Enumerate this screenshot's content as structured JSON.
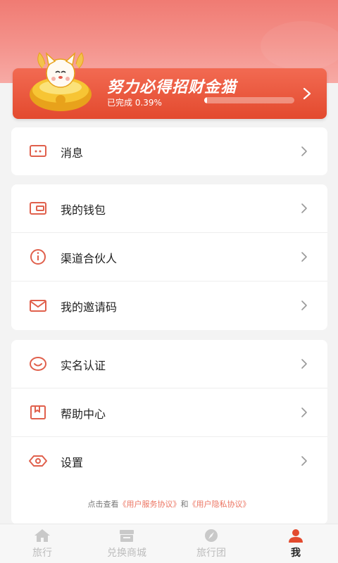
{
  "banner": {
    "title": "努力必得招财金猫",
    "progress_text": "已完成 0.39%",
    "progress_value": 0.0039
  },
  "menu_groups": [
    {
      "items": [
        {
          "label": "消息",
          "icon": "message-icon"
        }
      ]
    },
    {
      "items": [
        {
          "label": "我的钱包",
          "icon": "wallet-icon"
        },
        {
          "label": "渠道合伙人",
          "icon": "info-icon"
        },
        {
          "label": "我的邀请码",
          "icon": "mail-icon"
        }
      ]
    },
    {
      "items": [
        {
          "label": "实名认证",
          "icon": "smile-icon"
        },
        {
          "label": "帮助中心",
          "icon": "bookmark-icon"
        },
        {
          "label": "设置",
          "icon": "settings-eye-icon"
        }
      ]
    }
  ],
  "agreement": {
    "prefix": "点击查看",
    "service": "《用户服务协议》",
    "and": "和",
    "privacy": "《用户隐私协议》"
  },
  "tabbar": {
    "items": [
      {
        "label": "旅行",
        "icon": "home-icon"
      },
      {
        "label": "兑换商城",
        "icon": "store-icon"
      },
      {
        "label": "旅行团",
        "icon": "compass-icon"
      },
      {
        "label": "我",
        "icon": "user-icon"
      }
    ],
    "active": "我"
  },
  "colors": {
    "accent": "#e34a2e",
    "icon": "#e0604c",
    "link": "#ec7360"
  }
}
